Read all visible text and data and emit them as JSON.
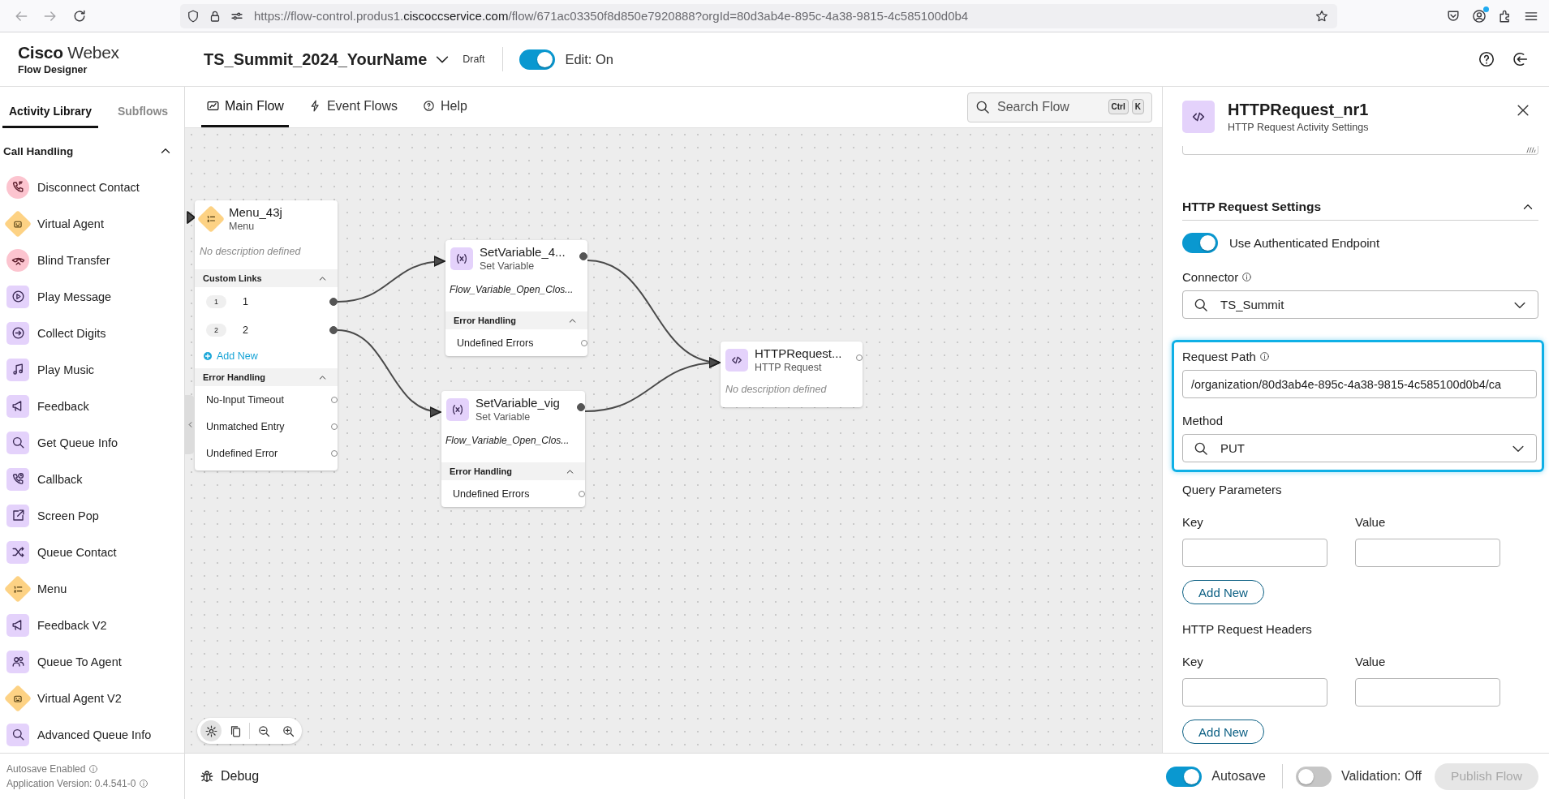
{
  "browser": {
    "url_host": "https://flow-control.produs1.",
    "url_domain": "ciscoccservice.com",
    "url_path": "/flow/671ac03350f8d850e7920888?orgId=80d3ab4e-895c-4a38-9815-4c585100d0b4",
    "account_notification": true
  },
  "header": {
    "brand": "Cisco",
    "brand_light": "Webex",
    "product": "Flow Designer",
    "flow_name": "TS_Summit_2024_YourName",
    "status": "Draft",
    "edit": {
      "label": "Edit: On",
      "on": true
    }
  },
  "sidebar": {
    "tabs": [
      {
        "label": "Activity Library",
        "selected": true
      },
      {
        "label": "Subflows",
        "selected": false
      }
    ],
    "section": {
      "title": "Call Handling",
      "expanded": true
    },
    "items": [
      {
        "label": "Disconnect Contact",
        "kind": "disconnect"
      },
      {
        "label": "Virtual Agent",
        "kind": "bot"
      },
      {
        "label": "Blind Transfer",
        "kind": "transfer"
      },
      {
        "label": "Play Message",
        "kind": "play"
      },
      {
        "label": "Collect Digits",
        "kind": "collect"
      },
      {
        "label": "Play Music",
        "kind": "music"
      },
      {
        "label": "Feedback",
        "kind": "feedback"
      },
      {
        "label": "Get Queue Info",
        "kind": "search"
      },
      {
        "label": "Callback",
        "kind": "callback"
      },
      {
        "label": "Screen Pop",
        "kind": "screenpop"
      },
      {
        "label": "Queue Contact",
        "kind": "queue"
      },
      {
        "label": "Menu",
        "kind": "menu"
      },
      {
        "label": "Feedback V2",
        "kind": "feedback"
      },
      {
        "label": "Queue To Agent",
        "kind": "people"
      },
      {
        "label": "Virtual Agent V2",
        "kind": "bot"
      },
      {
        "label": "Advanced Queue Info",
        "kind": "search"
      }
    ]
  },
  "canvas": {
    "tabs": [
      {
        "label": "Main Flow",
        "kind": "flow",
        "selected": true
      },
      {
        "label": "Event Flows",
        "kind": "event",
        "selected": false
      },
      {
        "label": "Help",
        "kind": "help",
        "selected": false
      }
    ],
    "search": {
      "placeholder": "Search Flow",
      "keys": [
        "Ctrl",
        "K"
      ]
    },
    "nodes": [
      {
        "kind": "menu",
        "title": "Menu_43j",
        "subtitle": "Menu",
        "description": "No description defined",
        "sections": [
          {
            "title": "Custom Links",
            "expanded": true,
            "rows": [
              {
                "badge": "1",
                "label": "1",
                "connected": true
              },
              {
                "badge": "2",
                "label": "2",
                "connected": true
              }
            ],
            "add_label": "Add New"
          },
          {
            "title": "Error Handling",
            "expanded": true,
            "rows": [
              {
                "label": "No-Input Timeout",
                "connected": false
              },
              {
                "label": "Unmatched Entry",
                "connected": false
              },
              {
                "label": "Undefined Error",
                "connected": false
              }
            ]
          }
        ]
      },
      {
        "kind": "variable",
        "title": "SetVariable_4...",
        "subtitle": "Set Variable",
        "variable": "Flow_Variable_Open_Clos...",
        "out_connected": true,
        "sections": [
          {
            "title": "Error Handling",
            "expanded": true,
            "rows": [
              {
                "label": "Undefined Errors",
                "connected": false
              }
            ]
          }
        ]
      },
      {
        "kind": "variable",
        "title": "SetVariable_vig",
        "subtitle": "Set Variable",
        "variable": "Flow_Variable_Open_Clos...",
        "out_connected": true,
        "sections": [
          {
            "title": "Error Handling",
            "expanded": true,
            "rows": [
              {
                "label": "Undefined Errors",
                "connected": false
              }
            ]
          }
        ]
      },
      {
        "kind": "http",
        "title": "HTTPRequest...",
        "subtitle": "HTTP Request",
        "description": "No description defined",
        "out_connected": false
      }
    ],
    "tools": [
      {
        "kind": "settings",
        "selected": true
      },
      {
        "kind": "copy",
        "selected": false
      },
      {
        "kind": "zoom-out",
        "selected": false
      },
      {
        "kind": "zoom-in",
        "selected": false
      }
    ]
  },
  "panel": {
    "title": "HTTPRequest_nr1",
    "subtitle": "HTTP Request Activity Settings",
    "section": {
      "title": "HTTP Request Settings",
      "expanded": true
    },
    "auth": {
      "label": "Use Authenticated Endpoint",
      "on": true
    },
    "connector": {
      "label": "Connector",
      "value": "TS_Summit"
    },
    "highlighted": true,
    "request_path": {
      "label": "Request Path",
      "value": "/organization/80d3ab4e-895c-4a38-9815-4c585100d0b4/ca"
    },
    "method": {
      "label": "Method",
      "value": "PUT"
    },
    "groups": [
      {
        "title": "Query Parameters",
        "key_label": "Key",
        "value_label": "Value",
        "button": "Add New"
      },
      {
        "title": "HTTP Request Headers",
        "key_label": "Key",
        "value_label": "Value",
        "button": "Add New"
      }
    ]
  },
  "footer": {
    "info": [
      "Autosave Enabled",
      "Application Version: 0.4.541-0"
    ],
    "debug": "Debug",
    "autosave": {
      "label": "Autosave",
      "on": true
    },
    "validation": {
      "label": "Validation: Off",
      "on": false
    },
    "publish": {
      "label": "Publish Flow",
      "disabled": true
    }
  }
}
